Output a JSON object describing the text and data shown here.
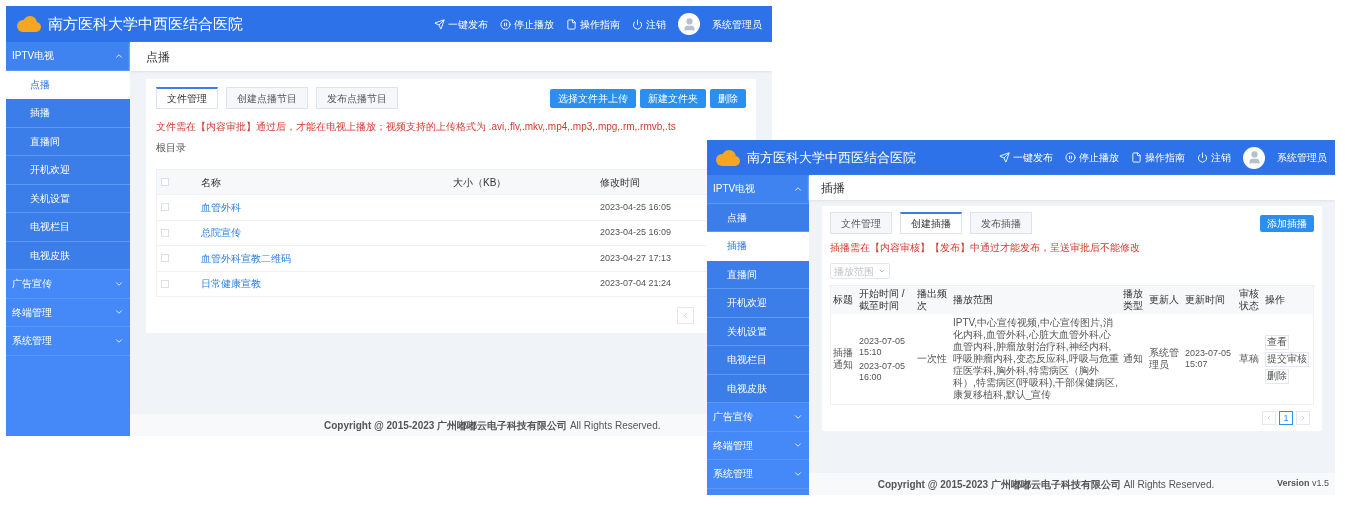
{
  "windows": [
    {
      "kind": "files",
      "brand": "南方医科大学中西医结合医院",
      "header_actions": [
        {
          "kind": "send",
          "label": "一键发布"
        },
        {
          "kind": "stop",
          "label": "停止播放"
        },
        {
          "kind": "doc",
          "label": "操作指南"
        },
        {
          "kind": "power",
          "label": "注销"
        }
      ],
      "user": "系统管理员",
      "sidebar": [
        {
          "label": "IPTV电视",
          "expanded": true,
          "children": [
            {
              "label": "点播",
              "selected": true
            },
            {
              "label": "插播",
              "selected": false
            },
            {
              "label": "直播间",
              "selected": false
            },
            {
              "label": "开机欢迎",
              "selected": false
            },
            {
              "label": "关机设置",
              "selected": false
            },
            {
              "label": "电视栏目",
              "selected": false
            },
            {
              "label": "电视皮肤",
              "selected": false
            }
          ]
        },
        {
          "label": "广告宣传",
          "expanded": false
        },
        {
          "label": "终端管理",
          "expanded": false
        },
        {
          "label": "系统管理",
          "expanded": false
        }
      ],
      "page_title": "点播",
      "tabs": [
        {
          "label": "文件管理",
          "selected": true
        },
        {
          "label": "创建点播节目",
          "selected": false
        },
        {
          "label": "发布点播节目",
          "selected": false
        }
      ],
      "buttons": [
        "选择文件并上传",
        "新建文件夹",
        "删除"
      ],
      "notice": "文件需在【内容审批】通过后，才能在电视上播放；视频支持的上传格式为 .avi,.flv,.mkv,.mp4,.mp3,.mpg,.rm,.rmvb,.ts",
      "path": "根目录",
      "columns": [
        "名称",
        "大小（KB）",
        "修改时间"
      ],
      "select_all": {
        "checked": false
      },
      "rows": [
        {
          "checked": false,
          "name": "血管外科",
          "time": "2023-04-25 16:05"
        },
        {
          "checked": false,
          "name": "总院宣传",
          "time": "2023-04-25 16:09"
        },
        {
          "checked": false,
          "name": "血管外科宣教二维码",
          "time": "2023-04-27 17:13"
        },
        {
          "checked": false,
          "name": "日常健康宣教",
          "time": "2023-07-04 21:24"
        }
      ],
      "footer": "**Copyright @ 2015-2023 广州嘟嘟云电子科技有限公司** All Rights Reserved."
    },
    {
      "kind": "schedule",
      "brand": "南方医科大学中西医结合医院",
      "header_actions": [
        {
          "kind": "send",
          "label": "一键发布"
        },
        {
          "kind": "stop",
          "label": "停止播放"
        },
        {
          "kind": "doc",
          "label": "操作指南"
        },
        {
          "kind": "power",
          "label": "注销"
        }
      ],
      "user": "系统管理员",
      "sidebar": [
        {
          "label": "IPTV电视",
          "expanded": true,
          "children": [
            {
              "label": "点播",
              "selected": false
            },
            {
              "label": "插播",
              "selected": true
            },
            {
              "label": "直播间",
              "selected": false
            },
            {
              "label": "开机欢迎",
              "selected": false
            },
            {
              "label": "关机设置",
              "selected": false
            },
            {
              "label": "电视栏目",
              "selected": false
            },
            {
              "label": "电视皮肤",
              "selected": false
            }
          ]
        },
        {
          "label": "广告宣传",
          "expanded": false
        },
        {
          "label": "终端管理",
          "expanded": false
        },
        {
          "label": "系统管理",
          "expanded": false
        }
      ],
      "page_title": "插播",
      "tabs": [
        {
          "label": "文件管理",
          "selected": false
        },
        {
          "label": "创建插播",
          "selected": true
        },
        {
          "label": "发布插播",
          "selected": false
        }
      ],
      "buttons": [
        "添加插播"
      ],
      "notice": "插播需在【内容审核】【发布】中通过才能发布，呈送审批后不能修改",
      "filter": {
        "placeholder": "播放范围"
      },
      "columns": [
        "标题",
        "开始时间 / 截至时间",
        "播出频次",
        "播放范围",
        "播放类型",
        "更新人",
        "更新时间",
        "审核状态",
        "操作"
      ],
      "rows": [
        {
          "title": "插播通知",
          "start": "2023-07-05 15:10",
          "end": "2023-07-05 16:00",
          "frequency": "一次性",
          "range": "IPTV,中心宣传视频,中心宣传图片,消化内科,血管外科,心脏大血管外科,心血管内科,肿瘤放射治疗科,神经内科,呼吸肿瘤内科,变态反应科,呼吸与危重症医学科,胸外科,特需病区（胸外科）,特需病区(呼吸科),干部保健病区,康复移植科,默认_宣传",
          "type": "通知",
          "updater": "系统管理员",
          "updated": "2023-07-05 15:07",
          "status": "草稿",
          "actions": [
            "查看",
            "提交审核",
            "删除"
          ]
        }
      ],
      "pages": [
        {
          "label": "1",
          "selected": true
        }
      ],
      "footer": "**Copyright @ 2015-2023 广州嘟嘟云电子科技有限公司** All Rights Reserved.",
      "version": "**Version** v1.5"
    }
  ]
}
